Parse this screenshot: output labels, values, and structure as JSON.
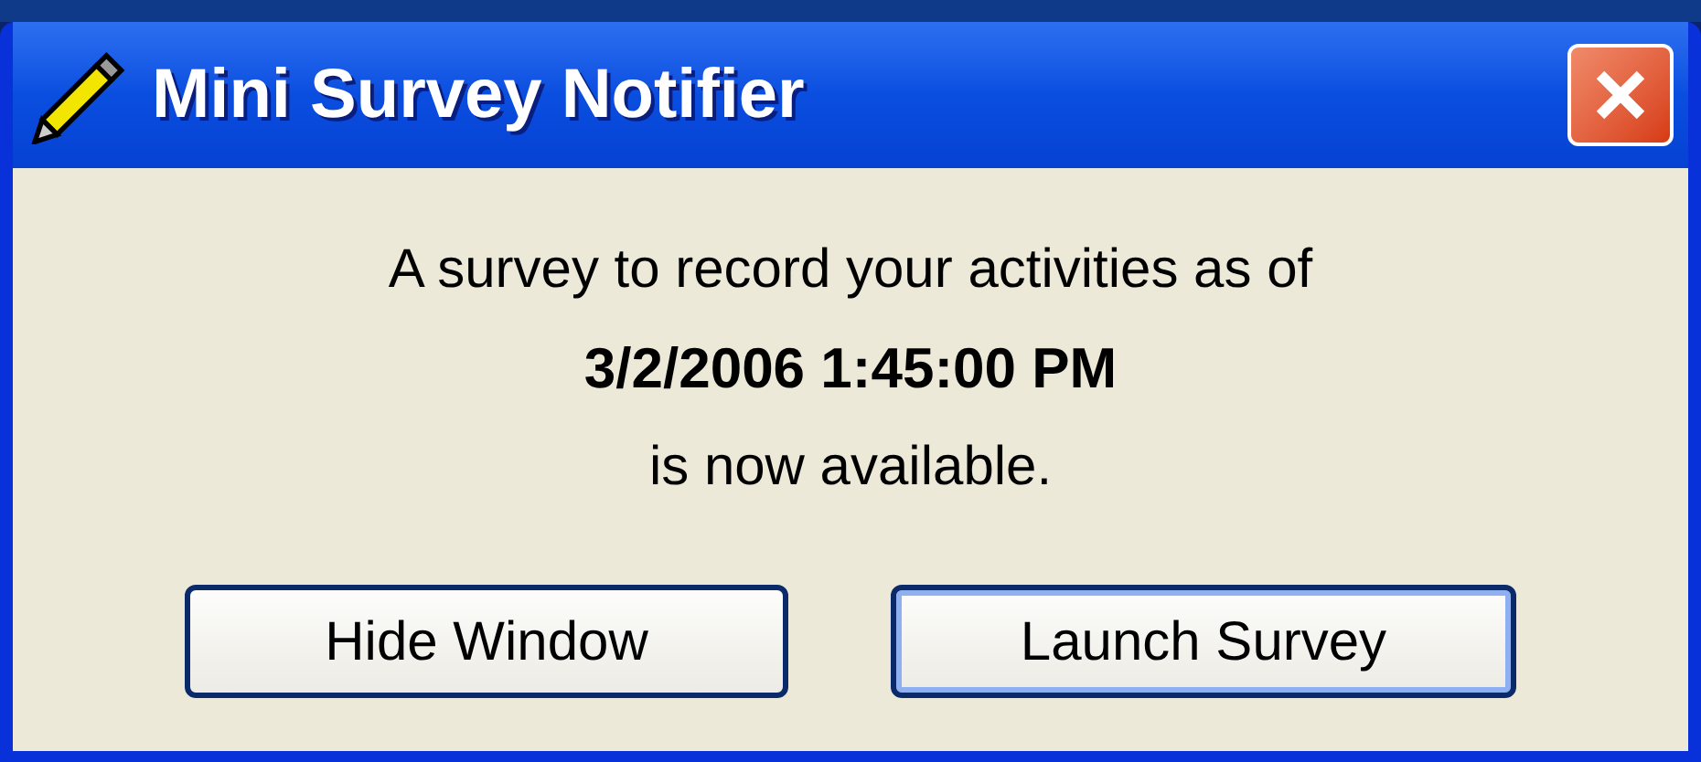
{
  "window": {
    "title": "Mini Survey Notifier"
  },
  "message": {
    "line_1": "A survey to record your activities as of",
    "timestamp": "3/2/2006 1:45:00 PM",
    "line_3": "is now available."
  },
  "buttons": [
    {
      "label": "Hide Window",
      "default": false
    },
    {
      "label": "Launch Survey",
      "default": true
    }
  ]
}
